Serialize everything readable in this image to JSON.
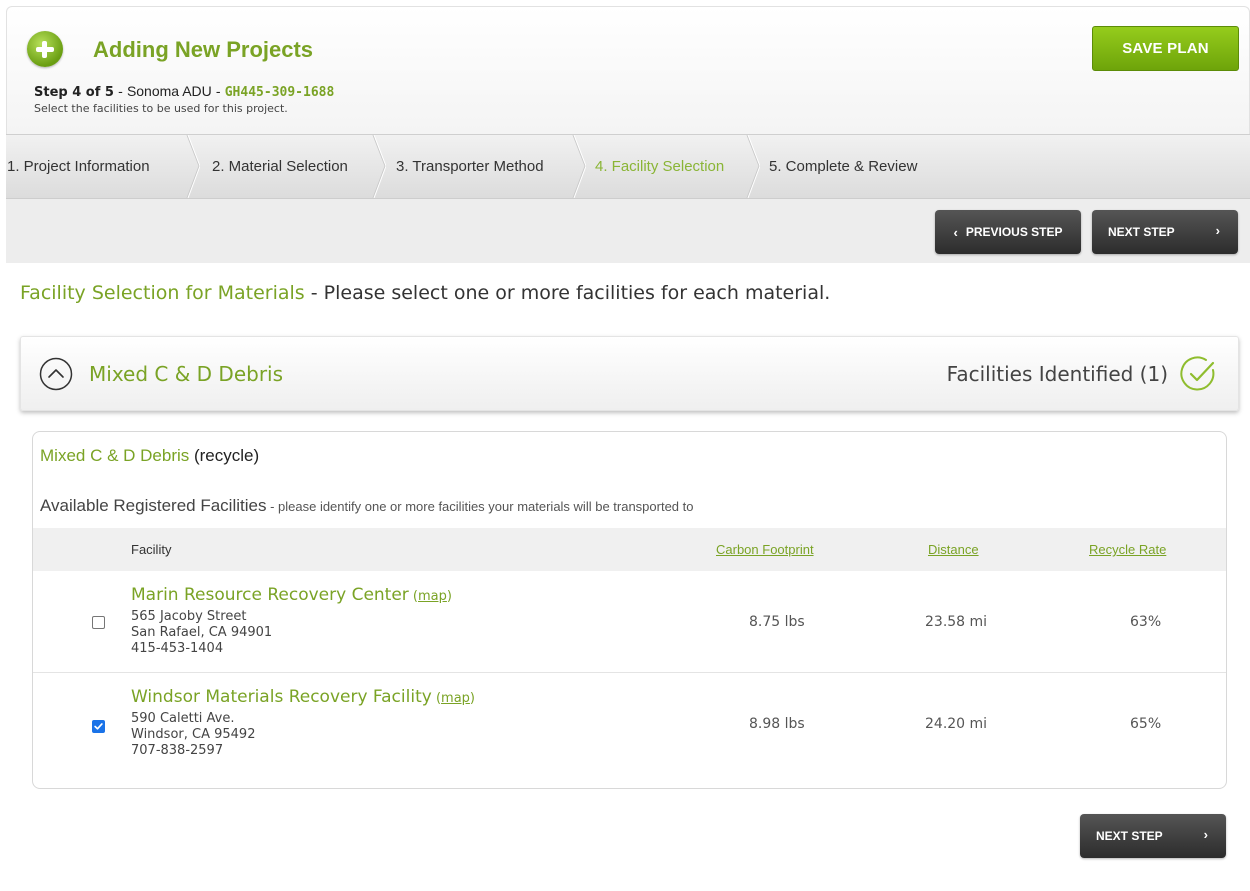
{
  "header": {
    "title": "Adding New Projects",
    "step_label": "Step 4 of 5",
    "sep1": " - ",
    "project_name": "Sonoma ADU",
    "sep2": " - ",
    "project_code": "GH445-309-1688",
    "subtitle": "Select the facilities to be used for this project.",
    "save_label": "SAVE PLAN"
  },
  "tabs": [
    {
      "label": "1. Project Information"
    },
    {
      "label": "2. Material Selection"
    },
    {
      "label": "3. Transporter Method"
    },
    {
      "label": "4. Facility Selection",
      "active": true
    },
    {
      "label": "5. Complete & Review"
    }
  ],
  "nav": {
    "prev_label": "PREVIOUS STEP",
    "next_label": "NEXT STEP",
    "prev_arrow": "‹",
    "next_arrow": "›"
  },
  "section": {
    "heading_green": "Facility Selection for Materials",
    "heading_rest": " - Please select one or more facilities for each material."
  },
  "accordion": {
    "title": "Mixed C & D Debris",
    "status": "Facilities Identified (1)"
  },
  "panel": {
    "material": "Mixed C & D Debris",
    "material_type": " (recycle)",
    "available_title": "Available Registered Facilities",
    "available_note": " - please identify one or more facilities your materials will be transported to",
    "columns": {
      "facility": "Facility",
      "carbon": "Carbon Footprint",
      "distance": "Distance",
      "recycle": "Recycle Rate"
    },
    "map_label": "map",
    "open_paren": " (",
    "close_paren": ")",
    "rows": [
      {
        "name": "Marin Resource Recovery Center",
        "street": "565 Jacoby Street",
        "city": "San Rafael, CA 94901",
        "phone": "415-453-1404",
        "carbon": "8.75 lbs",
        "distance": "23.58 mi",
        "recycle": "63%",
        "checked": false
      },
      {
        "name": "Windsor Materials Recovery Facility",
        "street": "590 Caletti Ave.",
        "city": "Windsor, CA 95492",
        "phone": "707-838-2597",
        "carbon": "8.98 lbs",
        "distance": "24.20 mi",
        "recycle": "65%",
        "checked": true
      }
    ]
  },
  "colors": {
    "brand_green": "#7aa325",
    "save_button": "#82b812",
    "dark_button": "#3a3a3a",
    "checkbox_checked": "#1a73e8"
  }
}
